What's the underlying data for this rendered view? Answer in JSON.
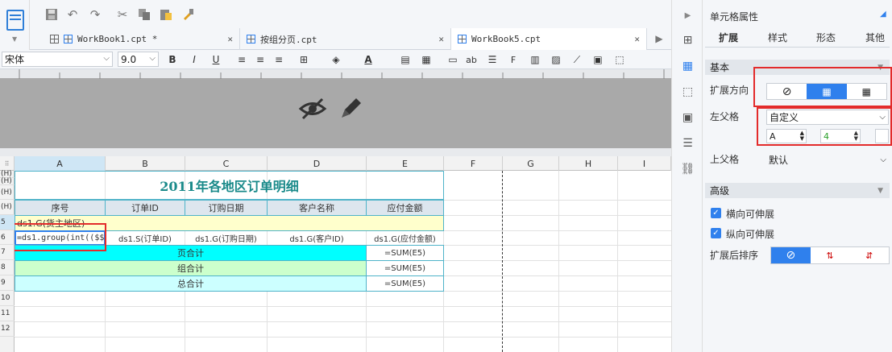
{
  "toolbar": {
    "icons": [
      "save-icon",
      "undo-icon",
      "redo-icon",
      "cut-icon",
      "copy-icon",
      "paste-icon",
      "format-painter-icon"
    ]
  },
  "tabs": [
    {
      "label": "WorkBook1.cpt *"
    },
    {
      "label": "按组分页.cpt"
    },
    {
      "label": "WorkBook5.cpt"
    }
  ],
  "format": {
    "font": "宋体",
    "size": "9.0",
    "bold": "B",
    "italic": "I",
    "underline": "U"
  },
  "columns": [
    "A",
    "B",
    "C",
    "D",
    "E",
    "F",
    "G",
    "H",
    "I"
  ],
  "rows": [
    "(H)",
    "(H)",
    "(H)",
    "(H)",
    "5",
    "6",
    "7",
    "8",
    "9",
    "10",
    "11",
    "12"
  ],
  "report": {
    "title": "2011年各地区订单明细",
    "headers": [
      "序号",
      "订单ID",
      "订购日期",
      "客户名称",
      "应付金额"
    ],
    "group_cell": "ds1.G(货主地区)",
    "r5": [
      "=ds1.group(int(($$",
      "ds1.S(订单ID)",
      "ds1.G(订购日期)",
      "ds1.G(客户ID)",
      "ds1.G(应付金额)"
    ],
    "page_total": "页合计",
    "group_total": "组合计",
    "grand_total": "总合计",
    "sum": "=SUM(E5)"
  },
  "panel": {
    "title": "单元格属性",
    "tabs": [
      "扩展",
      "样式",
      "形态",
      "其他"
    ],
    "basic": "基本",
    "expand_dir": "扩展方向",
    "left_parent": "左父格",
    "left_parent_value": "自定义",
    "left_col": "A",
    "left_row": "4",
    "upper_parent": "上父格",
    "upper_parent_value": "默认",
    "advanced": "高级",
    "h_expand": "横向可伸展",
    "v_expand": "纵向可伸展",
    "sort_after": "扩展后排序"
  },
  "colors": {
    "accent": "#2f80ed",
    "highlight": "#e32b2b",
    "title_teal": "#1a8a8a",
    "cyan": "#00ffff",
    "light_green": "#ccffcc",
    "light_yellow": "#ffffcc"
  }
}
